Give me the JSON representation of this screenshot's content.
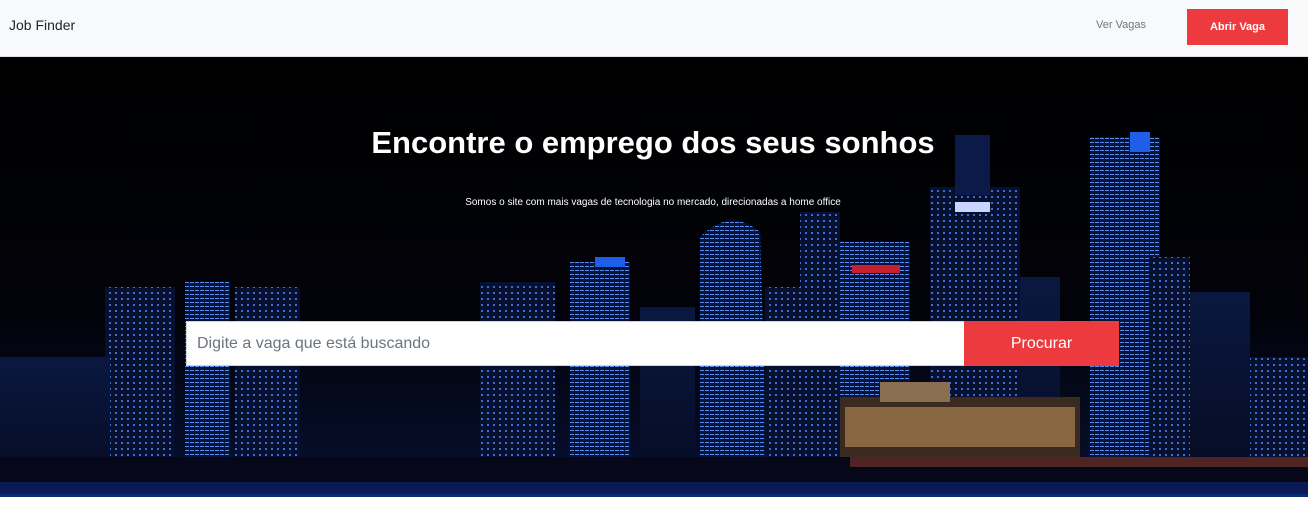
{
  "navbar": {
    "brand": "Job Finder",
    "link_label": "Ver Vagas",
    "button_label": "Abrir Vaga",
    "accent_color": "#ec3a3f"
  },
  "hero": {
    "title": "Encontre o emprego dos seus sonhos",
    "subtitle": "Somos o site com mais vagas de tecnologia no mercado, direcionadas a home office",
    "background": "night city skyline"
  },
  "search": {
    "placeholder": "Digite a vaga que está buscando",
    "value": "",
    "button_label": "Procurar"
  }
}
